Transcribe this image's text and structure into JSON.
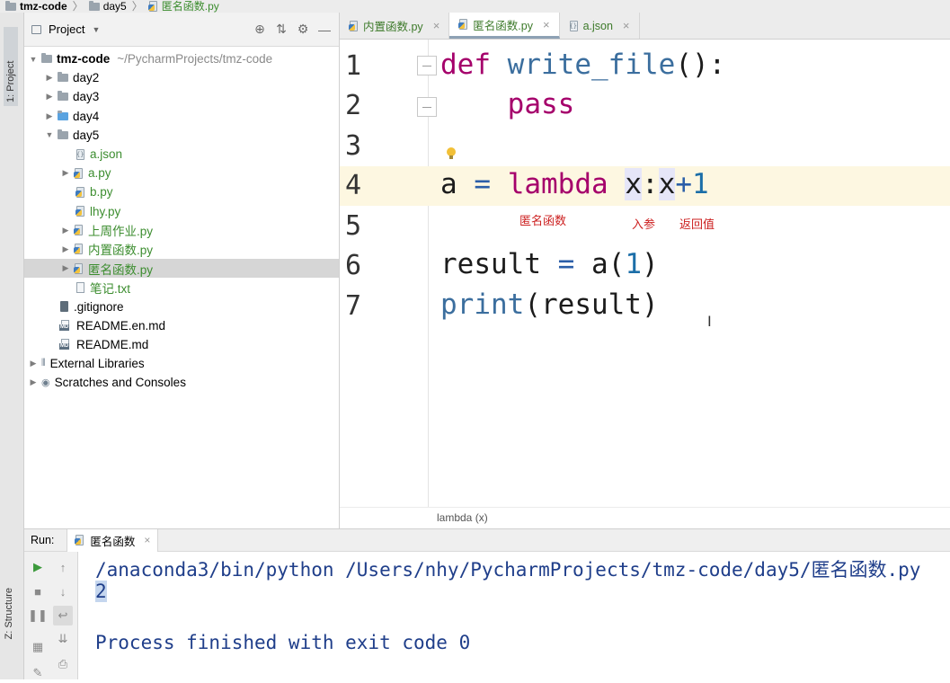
{
  "breadcrumb": {
    "project": "tmz-code",
    "folder": "day5",
    "file": "匿名函数.py"
  },
  "sidebar": {
    "project_tab": "1: Project",
    "structure_tab": "Z: Structure"
  },
  "project_panel": {
    "title": "Project",
    "tree": [
      {
        "label": "tmz-code",
        "path": "~/PycharmProjects/tmz-code",
        "icon": "folder-icon",
        "expanded": true
      },
      {
        "label": "day2",
        "icon": "folder-icon"
      },
      {
        "label": "day3",
        "icon": "folder-icon"
      },
      {
        "label": "day4",
        "icon": "folder-icon"
      },
      {
        "label": "day5",
        "icon": "folder-icon",
        "expanded": true
      },
      {
        "label": "a.json",
        "icon": "json-file-icon"
      },
      {
        "label": "a.py",
        "icon": "python-file-icon"
      },
      {
        "label": "b.py",
        "icon": "python-file-icon"
      },
      {
        "label": "lhy.py",
        "icon": "python-file-icon"
      },
      {
        "label": "上周作业.py",
        "icon": "python-file-icon"
      },
      {
        "label": "内置函数.py",
        "icon": "python-file-icon"
      },
      {
        "label": "匿名函数.py",
        "icon": "python-file-icon",
        "selected": true
      },
      {
        "label": "笔记.txt",
        "icon": "text-file-icon"
      },
      {
        "label": ".gitignore",
        "icon": "gitignore-file-icon"
      },
      {
        "label": "README.en.md",
        "icon": "markdown-file-icon"
      },
      {
        "label": "README.md",
        "icon": "markdown-file-icon"
      },
      {
        "label": "External Libraries",
        "icon": "library-icon"
      },
      {
        "label": "Scratches and Consoles",
        "icon": "scratches-icon"
      }
    ]
  },
  "editor": {
    "tabs": [
      {
        "label": "内置函数.py"
      },
      {
        "label": "匿名函数.py",
        "active": true
      },
      {
        "label": "a.json"
      }
    ],
    "line_numbers": [
      "1",
      "2",
      "3",
      "4",
      "5",
      "6",
      "7"
    ],
    "code": {
      "l1_kw": "def",
      "l1_fn": "write_file",
      "l1_rest": "():",
      "l2_kw": "pass",
      "l4_a": "a",
      "l4_eq": "=",
      "l4_kw": "lambda",
      "l4_x1": "x",
      "l4_colon": ":",
      "l4_x2": "x",
      "l4_plus": "+",
      "l4_num": "1",
      "l6_var": "result",
      "l6_eq": "=",
      "l6_call": "a(",
      "l6_num": "1",
      "l6_close": ")",
      "l7_fn": "print",
      "l7_args": "(result)"
    },
    "annotations": {
      "anonymous_function": "匿名函数",
      "input_param": "入参",
      "return_value": "返回值"
    },
    "status_hint": "lambda (x)"
  },
  "run_panel": {
    "label": "Run:",
    "tab": "匿名函数",
    "console_lines": {
      "command": "/anaconda3/bin/python /Users/nhy/PycharmProjects/tmz-code/day5/匿名函数.py",
      "output": "2",
      "finished": "Process finished with exit code 0"
    }
  },
  "colors": {
    "keyword": "#a5006b",
    "function": "#3b6e9e",
    "number": "#1b6ea8",
    "annotation": "#cc1f1f",
    "console_text": "#1f3e8a",
    "current_line": "#fdf7e1"
  }
}
